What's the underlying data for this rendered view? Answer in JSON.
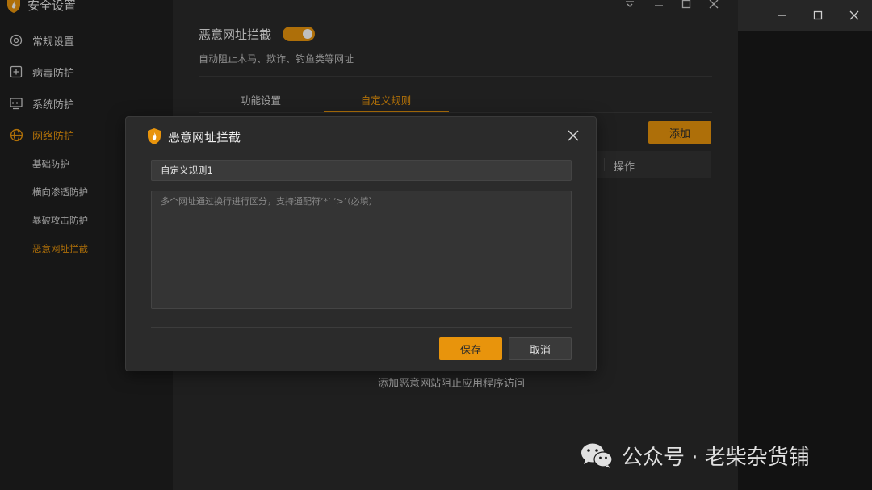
{
  "app": {
    "title": "安全设置"
  },
  "sidebar": {
    "items": [
      {
        "label": "常规设置",
        "icon": "gear-icon"
      },
      {
        "label": "病毒防护",
        "icon": "plus-box-icon"
      },
      {
        "label": "系统防护",
        "icon": "monitor-icon"
      },
      {
        "label": "网络防护",
        "icon": "globe-icon"
      }
    ],
    "sub_items": [
      {
        "label": "基础防护"
      },
      {
        "label": "横向渗透防护"
      },
      {
        "label": "暴破攻击防护"
      },
      {
        "label": "恶意网址拦截"
      }
    ]
  },
  "main": {
    "feature_title": "恶意网址拦截",
    "feature_enabled": true,
    "feature_desc": "自动阻止木马、欺诈、钓鱼类等网址",
    "tabs": [
      {
        "label": "功能设置"
      },
      {
        "label": "自定义规则"
      }
    ],
    "add_label": "添加",
    "table": {
      "op_header": "操作"
    },
    "empty_text": "添加恶意网站阻止应用程序访问"
  },
  "dialog": {
    "title": "恶意网址拦截",
    "name_value": "自定义规则1",
    "urls_placeholder": "多个网址通过换行进行区分，支持通配符‘*’ ‘>’（必填）",
    "save_label": "保存",
    "cancel_label": "取消"
  },
  "watermark": {
    "text": "公众号 · 老柴杂货铺"
  },
  "colors": {
    "accent": "#e8940c",
    "panel": "#2a2a2a",
    "sidebar": "#1f1f1f"
  }
}
